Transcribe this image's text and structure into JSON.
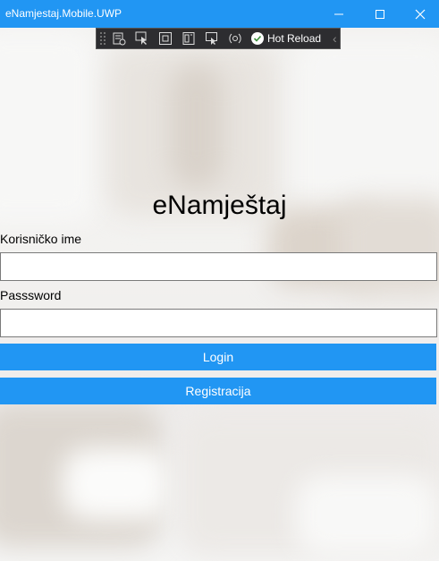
{
  "window": {
    "title": "eNamjestaj.Mobile.UWP",
    "accent_color": "#2196f3"
  },
  "debug_toolbar": {
    "icons": [
      "live-visual-tree-icon",
      "select-element-icon",
      "display-adorners-icon",
      "track-focus-icon",
      "display-layout-icon",
      "binding-failures-icon"
    ],
    "hot_reload_label": "Hot Reload"
  },
  "app": {
    "title": "eNamještaj"
  },
  "login_form": {
    "username_label": "Korisničko ime",
    "username_value": "",
    "password_label": "Passsword",
    "password_value": "",
    "login_button": "Login",
    "register_button": "Registracija"
  }
}
